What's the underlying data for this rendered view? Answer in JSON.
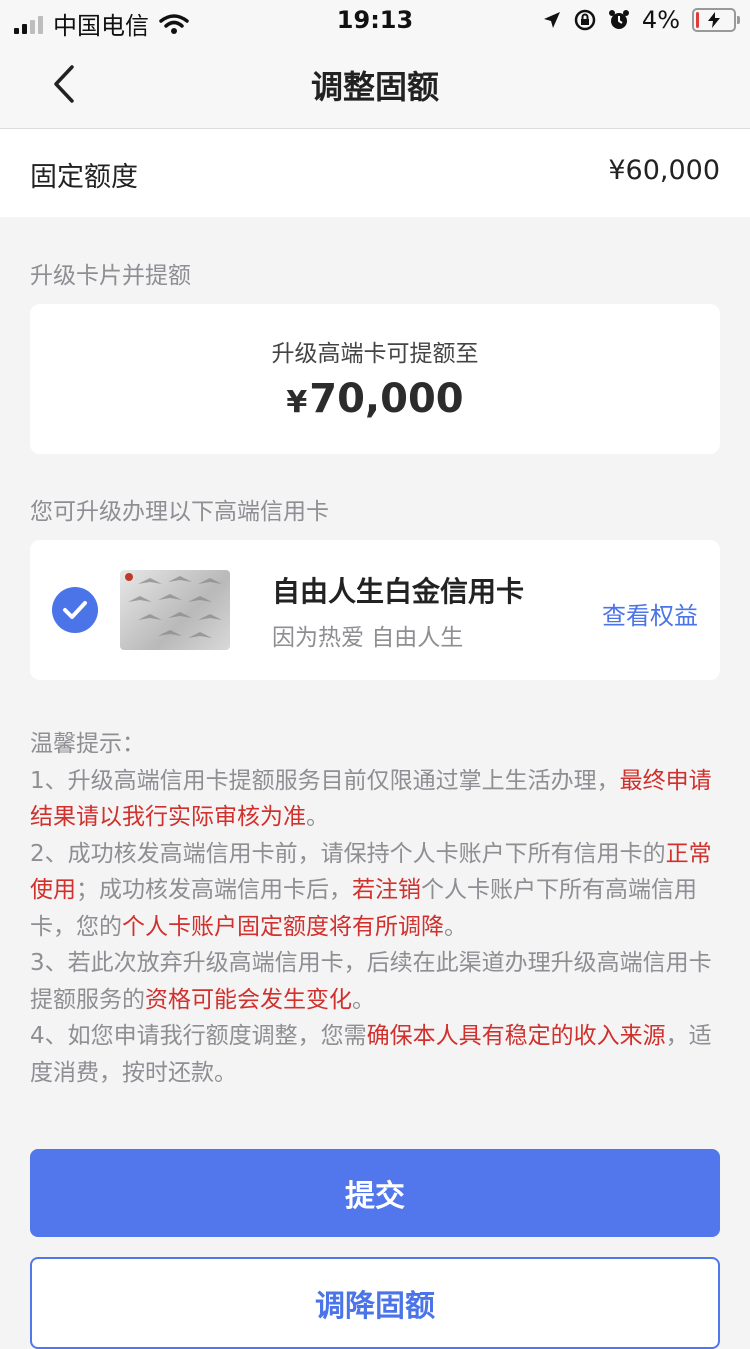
{
  "status_bar": {
    "carrier": "中国电信",
    "time": "19:13",
    "battery": "4%"
  },
  "nav": {
    "title": "调整固额"
  },
  "fixed_quota": {
    "label": "固定额度",
    "value": "¥60,000"
  },
  "upgrade": {
    "section_title": "升级卡片并提额",
    "caption": "升级高端卡可提额至",
    "currency": "¥",
    "amount": "70,000"
  },
  "cards": {
    "section_title": "您可升级办理以下高端信用卡",
    "name": "自由人生白金信用卡",
    "slogan": "因为热爱 自由人生",
    "link": "查看权益",
    "selected": true
  },
  "tips": {
    "title": "温馨提示：",
    "item1_text": "1、升级高端信用卡提额服务目前仅限通过掌上生活办理，",
    "item1_hl": "最终申请结果请以我行实际审核为准",
    "item1_end": "。",
    "item2_text1": "2、成功核发高端信用卡前，请保持个人卡账户下所有信用卡的",
    "item2_hl1": "正常使用",
    "item2_text2": "；成功核发高端信用卡后，",
    "item2_hl2": "若注销",
    "item2_text3": "个人卡账户下所有高端信用卡，您的",
    "item2_hl3": "个人卡账户固定额度将有所调降",
    "item2_end": "。",
    "item3_text": "3、若此次放弃升级高端信用卡，后续在此渠道办理升级高端信用卡提额服务的",
    "item3_hl": "资格可能会发生变化",
    "item3_end": "。",
    "item4_text": "4、如您申请我行额度调整，您需",
    "item4_hl": "确保本人具有稳定的收入来源",
    "item4_end": "，适度消费，按时还款。"
  },
  "buttons": {
    "submit": "提交",
    "reduce": "调降固额"
  },
  "colors": {
    "primary": "#5277ec",
    "highlight": "#d0312d",
    "muted": "#8e8e93"
  }
}
